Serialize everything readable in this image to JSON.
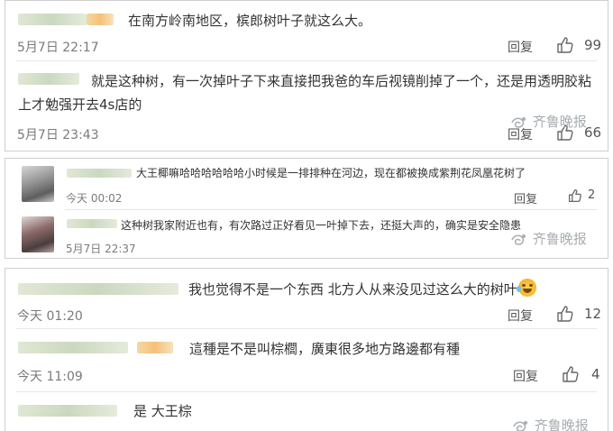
{
  "colors": {
    "name_green": "#cbd8bf",
    "name_orange": "#f4c178",
    "text": "#333333",
    "meta": "#7a7a7a"
  },
  "icons": {
    "thumb": "thumbs-up-icon",
    "watermark": "qilu-evening-news-logo-icon",
    "emoji": "laughing-crying-emoji"
  },
  "panel1": {
    "c1": {
      "text": "在南方岭南地区，槟郎树叶子就这么大。",
      "time": "5月7日 22:17",
      "reply": "回复",
      "likes": "99"
    },
    "c2": {
      "text": "就是这种树，有一次掉叶子下来直接把我爸的车后视镜削掉了一个，还是用透明胶粘上才勉强开去4s店的",
      "time": "5月7日 23:43",
      "reply": "回复",
      "likes": "66"
    },
    "watermark": "齐鲁晚报"
  },
  "panel2": {
    "c1": {
      "text": "大王椰嘛哈哈哈哈哈哈小时候是一排排种在河边，现在都被换成紫荆花凤凰花树了",
      "time": "今天 00:02",
      "reply": "回复",
      "likes": "2"
    },
    "c2": {
      "text": "这种树我家附近也有，有次路过正好看见一叶掉下去，还挺大声的，确实是安全隐患",
      "time": "5月7日 22:37"
    },
    "watermark": "齐鲁晚报"
  },
  "panel3": {
    "c1": {
      "text": "我也觉得不是一个东西 北方人从来没见过这么大的树叶",
      "time": "今天 01:20",
      "reply": "回复",
      "likes": "12"
    },
    "c2": {
      "text": "這種是不是叫棕櫚，廣東很多地方路邊都有種",
      "time": "今天 11:09",
      "reply": "回复",
      "likes": "4"
    },
    "c3": {
      "text": "是 大王棕"
    },
    "watermark": "齐鲁晚报"
  }
}
